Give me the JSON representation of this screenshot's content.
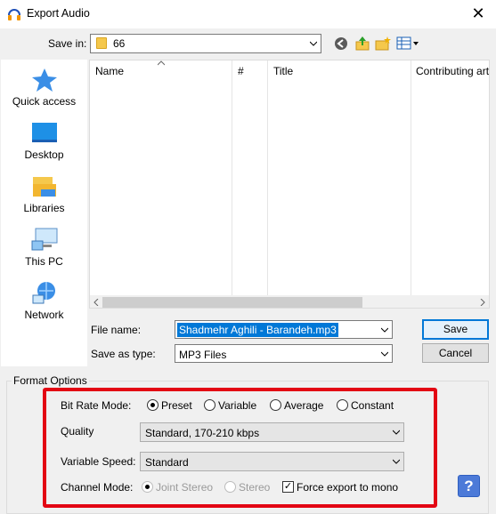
{
  "window": {
    "title": "Export Audio"
  },
  "save_in": {
    "label": "Save in:",
    "value": "66"
  },
  "places": [
    {
      "label": "Quick access",
      "icon": "quick-access-icon"
    },
    {
      "label": "Desktop",
      "icon": "desktop-icon"
    },
    {
      "label": "Libraries",
      "icon": "libraries-icon"
    },
    {
      "label": "This PC",
      "icon": "this-pc-icon"
    },
    {
      "label": "Network",
      "icon": "network-icon"
    }
  ],
  "columns": [
    "Name",
    "#",
    "Title",
    "Contributing art"
  ],
  "file_name": {
    "label": "File name:",
    "value": "Shadmehr Aghili - Barandeh.mp3"
  },
  "save_as_type": {
    "label": "Save as type:",
    "value": "MP3 Files"
  },
  "buttons": {
    "save": "Save",
    "cancel": "Cancel"
  },
  "format_options": {
    "title": "Format Options",
    "bit_rate_mode": {
      "label": "Bit Rate Mode:",
      "options": [
        "Preset",
        "Variable",
        "Average",
        "Constant"
      ],
      "selected": "Preset"
    },
    "quality": {
      "label": "Quality",
      "value": "Standard, 170-210 kbps"
    },
    "variable_speed": {
      "label": "Variable Speed:",
      "value": "Standard"
    },
    "channel_mode": {
      "label": "Channel Mode:",
      "joint_stereo": "Joint Stereo",
      "stereo": "Stereo",
      "force_mono": "Force export to mono",
      "force_mono_checked": true
    },
    "help": "?"
  },
  "colors": {
    "highlight": "#0078d7",
    "red_outline": "#e30613"
  }
}
